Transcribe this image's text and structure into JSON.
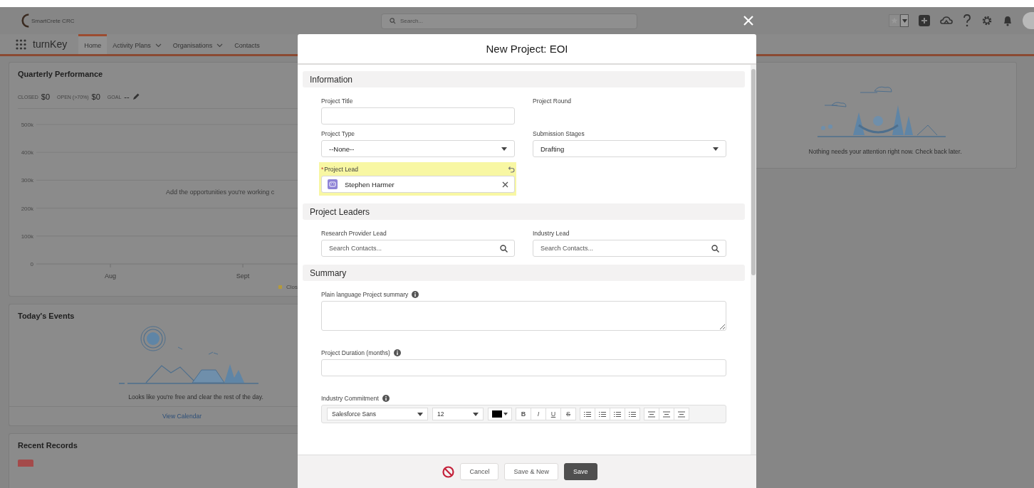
{
  "header": {
    "logo_text": "SmartCrete CRC",
    "search": {
      "placeholder": "Search..."
    }
  },
  "nav": {
    "app_name": "turnKey",
    "tabs": [
      {
        "label": "Home",
        "selected": true,
        "has_menu": false
      },
      {
        "label": "Activity Plans",
        "selected": false,
        "has_menu": true
      },
      {
        "label": "Organisations",
        "selected": false,
        "has_menu": true
      },
      {
        "label": "Contacts",
        "selected": false,
        "has_menu": false
      }
    ]
  },
  "quarterly_performance": {
    "title": "Quarterly Performance",
    "metrics": [
      {
        "label": "CLOSED",
        "value": "$0",
        "editable": false
      },
      {
        "label": "OPEN (>70%)",
        "value": "$0",
        "editable": false
      },
      {
        "label": "GOAL",
        "value": "--",
        "editable": true
      }
    ],
    "chart_data": {
      "type": "line",
      "grid": true,
      "categories": [
        "Aug",
        "Sept"
      ],
      "ylim": [
        0,
        500000
      ],
      "yticks": [
        {
          "value": 0,
          "label": "0"
        },
        {
          "value": 100000,
          "label": "100k"
        },
        {
          "value": 200000,
          "label": "200k"
        },
        {
          "value": 300000,
          "label": "300k"
        },
        {
          "value": 400000,
          "label": "400k"
        },
        {
          "value": 500000,
          "label": "500k"
        }
      ]
    },
    "empty_message": "Add the opportunities you're working c",
    "legend_label": "Clos"
  },
  "todays_events": {
    "title": "Today's Events",
    "message": "Looks like you're free and clear the rest of the day.",
    "link": "View Calendar"
  },
  "recent_records": {
    "title": "Recent Records"
  },
  "assistant": {
    "message": "Nothing needs your attention right now. Check back later."
  },
  "modal": {
    "title": "New Project: EOI",
    "sections": [
      {
        "title": "Information",
        "kind": "paired",
        "fields": [
          {
            "label": "Project Title",
            "kind": "text",
            "info": false
          },
          {
            "label": "Project Round",
            "kind": "none",
            "info": false
          },
          {
            "label": "Project Type",
            "kind": "select",
            "value": "--None--",
            "info": false
          },
          {
            "label": "Submission Stages",
            "kind": "select",
            "value": "Drafting",
            "info": false
          },
          {
            "label": "Project Lead",
            "kind": "lookup",
            "required_mark": "*",
            "changed": true,
            "value": "Stephen Harmer",
            "info": false
          }
        ]
      },
      {
        "title": "Project Leaders",
        "kind": "paired",
        "fields": [
          {
            "label": "Research Provider Lead",
            "kind": "search",
            "placeholder": "Search Contacts...",
            "info": false
          },
          {
            "label": "Industry Lead",
            "kind": "search",
            "placeholder": "Search Contacts...",
            "info": false
          }
        ]
      },
      {
        "title": "Summary",
        "kind": "stacked",
        "fields": [
          {
            "label": "Plain language Project summary",
            "kind": "textarea",
            "info": true
          },
          {
            "label": "Project Duration (months)",
            "kind": "text",
            "info": true
          },
          {
            "label": "Industry Commitment",
            "kind": "richtext",
            "info": true,
            "font": "Salesforce Sans",
            "size": "12",
            "format_buttons": [
              "B",
              "I",
              "U",
              "S"
            ]
          }
        ]
      }
    ],
    "buttons": [
      {
        "label": "Cancel",
        "kind": "neutral"
      },
      {
        "label": "Save & New",
        "kind": "neutral"
      },
      {
        "label": "Save",
        "kind": "brand"
      }
    ]
  }
}
